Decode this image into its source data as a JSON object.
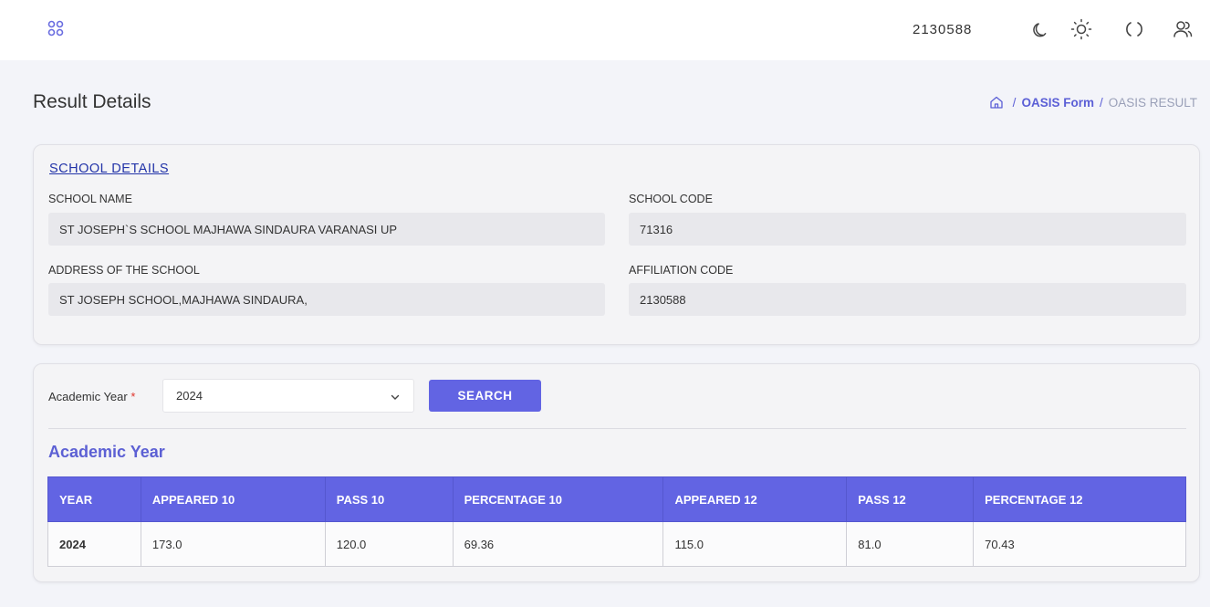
{
  "topbar": {
    "menu_icon": "grid-dots-icon",
    "user_code": "2130588",
    "icons": [
      "moon-icon",
      "sun-icon",
      "fullscreen-icon",
      "users-icon"
    ]
  },
  "page": {
    "title": "Result Details"
  },
  "breadcrumb": {
    "separator": "/",
    "items": [
      "OASIS Form",
      "OASIS RESULT"
    ]
  },
  "school_details": {
    "heading": "SCHOOL DETAILS",
    "school_name_label": "SCHOOL NAME",
    "school_name_value": "ST JOSEPH`S SCHOOL MAJHAWA SINDAURA VARANASI UP",
    "school_code_label": "SCHOOL CODE",
    "school_code_value": "71316",
    "address_label": "ADDRESS OF THE SCHOOL",
    "address_value": "ST JOSEPH SCHOOL,MAJHAWA SINDAURA,",
    "affiliation_label": "AFFILIATION CODE",
    "affiliation_value": "2130588"
  },
  "search": {
    "academic_year_label": "Academic Year",
    "required_mark": "*",
    "selected_year": "2024",
    "search_label": "SEARCH"
  },
  "results": {
    "title": "Academic Year",
    "columns": [
      "YEAR",
      "APPEARED 10",
      "PASS 10",
      "PERCENTAGE 10",
      "APPEARED 12",
      "PASS 12",
      "PERCENTAGE 12"
    ],
    "rows": [
      [
        "2024",
        "173.0",
        "120.0",
        "69.36",
        "115.0",
        "81.0",
        "70.43"
      ]
    ]
  },
  "colors": {
    "accent": "#6264e3",
    "link": "#2233a8",
    "required": "#e0342c"
  }
}
